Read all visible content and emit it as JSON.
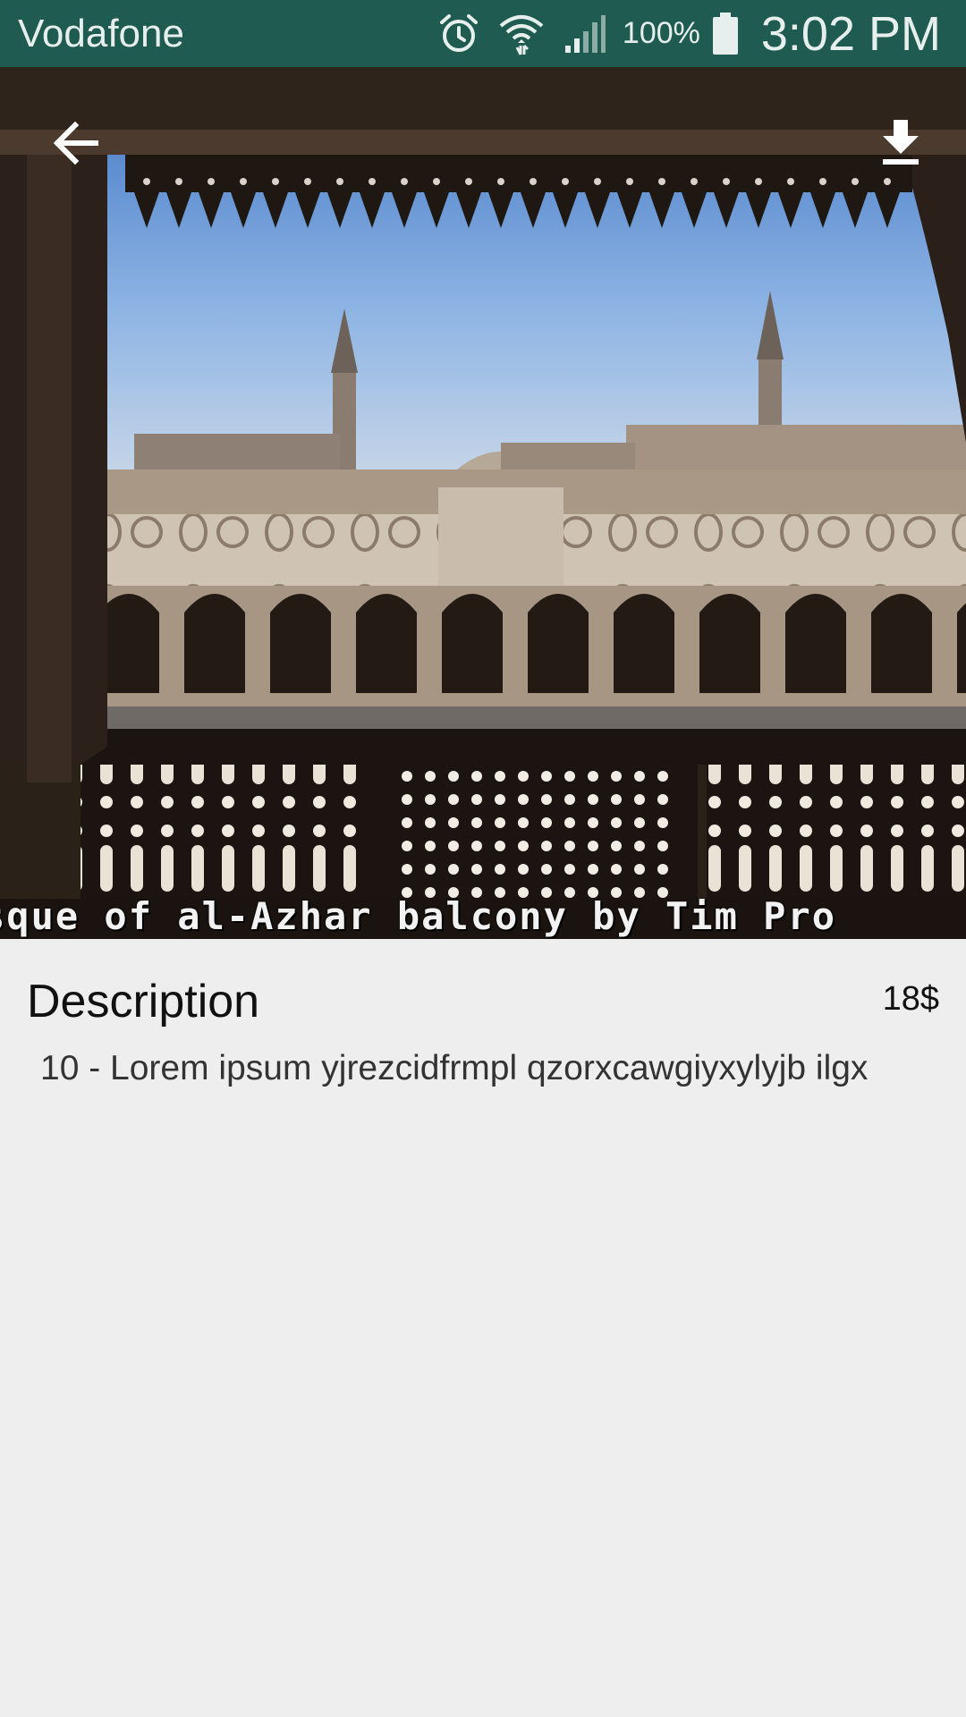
{
  "status_bar": {
    "carrier": "Vodafone",
    "battery_percent": "100%",
    "time": "3:02 PM",
    "icons": [
      "alarm-icon",
      "wifi-icon",
      "cell-signal-icon",
      "battery-icon"
    ],
    "background_color": "#1f5b50"
  },
  "photo": {
    "subject": "al-Azhar mosque courtyard viewed from balcony",
    "caption_overlay": "sque of al-Azhar balcony by Tim Pro"
  },
  "toolbar": {
    "back_icon": "arrow-left-icon",
    "download_icon": "download-icon"
  },
  "details": {
    "title": "Description",
    "price": "18$",
    "body": "10 - Lorem ipsum yjrezcidfrmpl qzorxcawgiyxylyjb ilgx"
  }
}
